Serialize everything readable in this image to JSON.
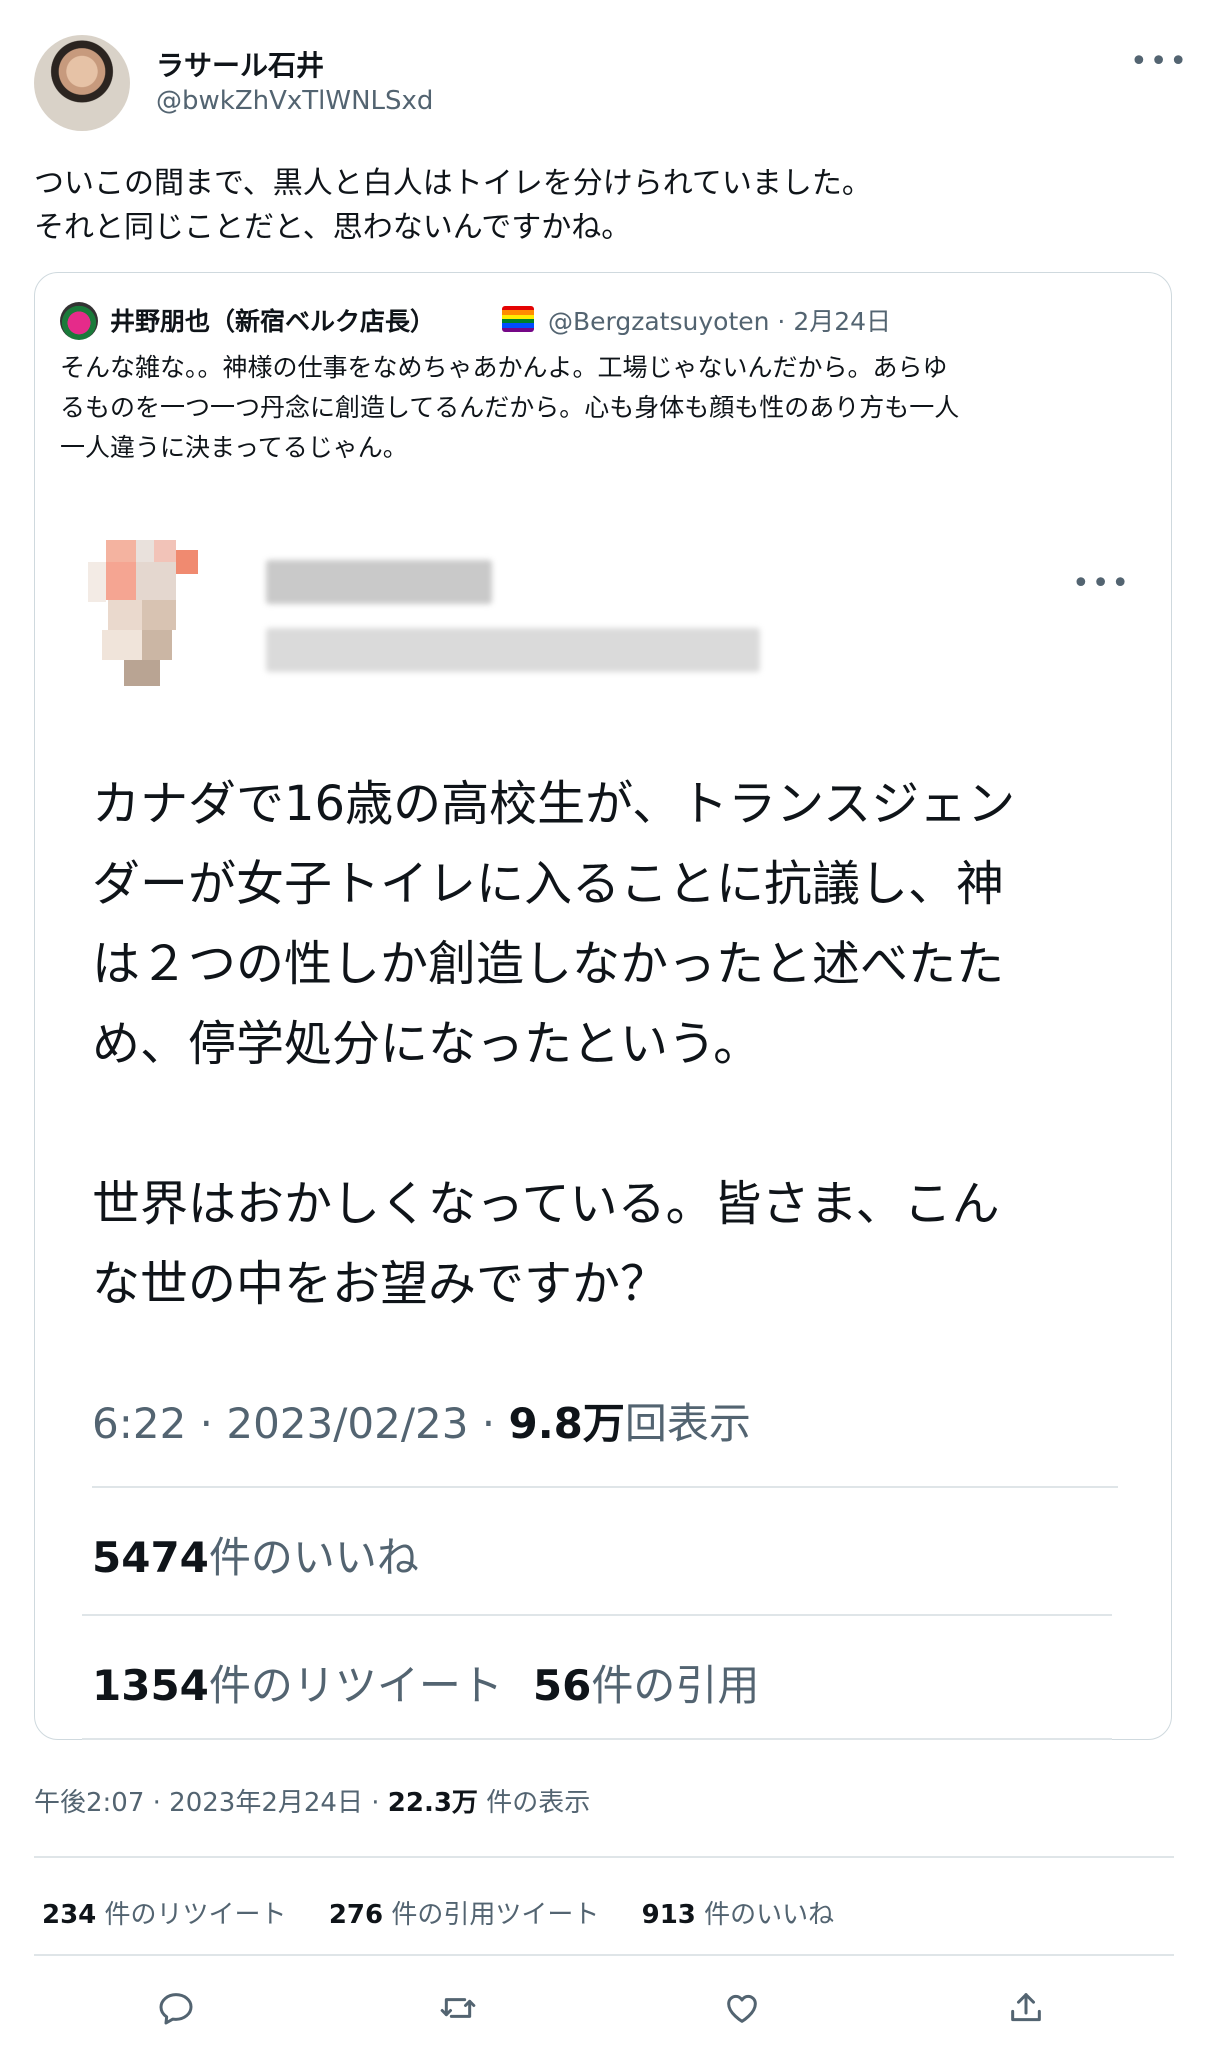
{
  "author": {
    "name": "ラサール石井",
    "handle": "@bwkZhVxTlWNLSxd"
  },
  "tweet_text": [
    "ついこの間まで、黒人と白人はトイレを分けられていました。",
    "それと同じことだと、思わないんですかね。"
  ],
  "quote": {
    "name": "井野朋也（新宿ベルク店長）",
    "handle_date": "@Bergzatsuyoten · 2月24日",
    "text": [
      "そんな雑な。。神様の仕事をなめちゃあかんよ。工場じゃないんだから。あらゆ",
      "るものを一つ一つ丹念に創造してるんだから。心も身体も顔も性のあり方も一人",
      "一人違うに決まってるじゃん。"
    ],
    "screenshot": {
      "text": [
        "カナダで16歳の高校生が、トランスジェン",
        "ダーが女子トイレに入ることに抗議し、神",
        "は２つの性しか創造しなかったと述べたた",
        "め、停学処分になったという。",
        "",
        "世界はおかしくなっている。皆さま、こん",
        "な世の中をお望みですか？"
      ],
      "time_date": "6:22 · 2023/02/23 · ",
      "views_count": "9.8万",
      "views_label": "回表示",
      "likes_count": "5474",
      "likes_label": "件のいいね",
      "retweets_count": "1354",
      "retweets_label": "件のリツイート",
      "quotes_count": "56",
      "quotes_label": "件の引用"
    }
  },
  "tweet_meta": {
    "time_date": "午後2:07 · 2023年2月24日 · ",
    "views_count": "22.3万",
    "views_label": " 件の表示"
  },
  "counts": {
    "retweets_count": "234",
    "retweets_label": " 件のリツイート",
    "quotes_count": "276",
    "quotes_label": " 件の引用ツイート",
    "likes_count": "913",
    "likes_label": " 件のいいね"
  },
  "more_glyph": "•••",
  "icons": [
    "reply-icon",
    "retweet-icon",
    "like-icon",
    "share-icon"
  ]
}
